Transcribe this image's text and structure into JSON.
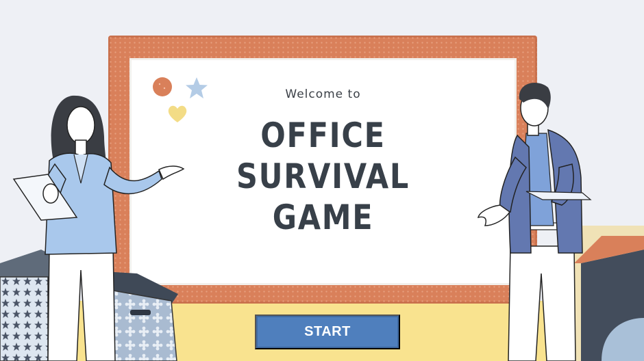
{
  "intro": {
    "welcome_text": "Welcome to",
    "title_lines": [
      "OFFICE",
      "SURVIVAL",
      "GAME"
    ]
  },
  "actions": {
    "start_label": "START"
  },
  "decor": {
    "icons": [
      "circle-sticker-icon",
      "star-sticker-icon",
      "heart-sticker-icon"
    ],
    "characters": [
      "woman-presenter-illustration",
      "man-presenter-illustration"
    ],
    "props": [
      "box-stack-left",
      "geometric-block-right"
    ]
  },
  "colors": {
    "board_frame": "#d9805a",
    "screen": "#ffffff",
    "title_text": "#384049",
    "start_button": "#4f7fbd",
    "floor": "#f9e38f",
    "woman_jacket": "#a9c8ec",
    "man_jacket": "#6378b0"
  }
}
